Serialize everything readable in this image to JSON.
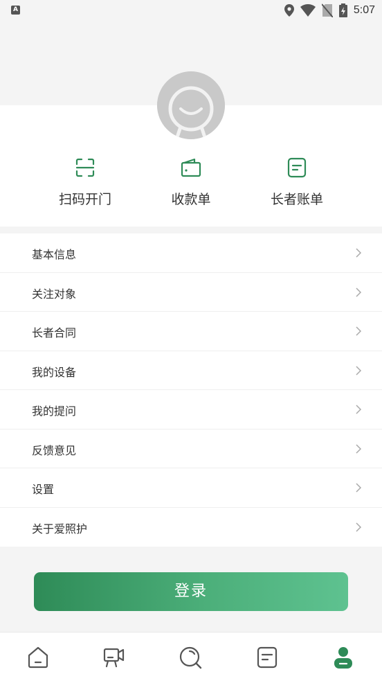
{
  "status_bar": {
    "left_icon": "A",
    "time": "5:07",
    "icons": [
      "location-icon",
      "wifi-icon",
      "no-sim-icon",
      "battery-charging-icon"
    ]
  },
  "profile": {
    "avatar": "default-avatar"
  },
  "quick_actions": [
    {
      "label": "扫码开门",
      "icon": "scan-icon"
    },
    {
      "label": "收款单",
      "icon": "wallet-icon"
    },
    {
      "label": "长者账单",
      "icon": "bill-icon"
    }
  ],
  "menu": {
    "items": [
      {
        "label": "基本信息"
      },
      {
        "label": "关注对象"
      },
      {
        "label": "长者合同"
      },
      {
        "label": "我的设备"
      },
      {
        "label": "我的提问"
      },
      {
        "label": "反馈意见"
      },
      {
        "label": "设置"
      },
      {
        "label": "关于爱照护"
      }
    ]
  },
  "login_button": {
    "label": "登录"
  },
  "tabbar": {
    "tabs": [
      {
        "icon": "home-icon",
        "active": false
      },
      {
        "icon": "video-icon",
        "active": false
      },
      {
        "icon": "discover-icon",
        "active": false
      },
      {
        "icon": "list-icon",
        "active": false
      },
      {
        "icon": "profile-icon",
        "active": true
      }
    ]
  },
  "colors": {
    "accent": "#2e8b57",
    "accent_light": "#5ec290",
    "icon_gray": "#555555",
    "background": "#f4f4f4"
  }
}
